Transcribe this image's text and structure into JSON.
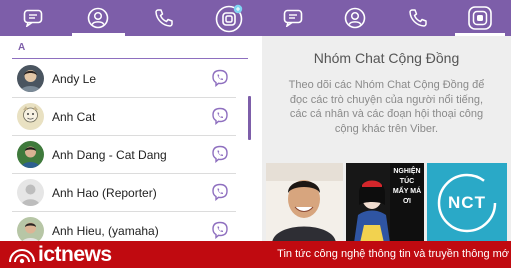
{
  "left_panel": {
    "tabs": [
      {
        "icon": "chat-icon",
        "active": false
      },
      {
        "icon": "contacts-icon",
        "active": true
      },
      {
        "icon": "call-icon",
        "active": false
      },
      {
        "icon": "public-chats-icon",
        "active": false,
        "badge": "new"
      }
    ],
    "section_letter": "A",
    "contacts": [
      {
        "name": "Andy Le"
      },
      {
        "name": "Anh Cat"
      },
      {
        "name": "Anh Dang - Cat Dang"
      },
      {
        "name": "Anh Hao (Reporter)"
      },
      {
        "name": "Anh Hieu, (yamaha)"
      }
    ]
  },
  "right_panel": {
    "tabs": [
      {
        "icon": "chat-icon",
        "active": false
      },
      {
        "icon": "contacts-icon",
        "active": false
      },
      {
        "icon": "call-icon",
        "active": false
      },
      {
        "icon": "public-chats-icon",
        "active": true
      }
    ],
    "title": "Nhóm Chat Cộng Đồng",
    "description": "Theo dõi các Nhóm Chat Cộng Đồng để đọc các trò chuyện của người nổi tiếng, các cá nhân và các đoạn hội thoại công cộng khác trên Viber.",
    "cards": [
      {
        "label": ""
      },
      {
        "label": "NGHIỆN TÚC MẤY MÁ ƠI"
      },
      {
        "label": "NCT"
      }
    ]
  },
  "banner": {
    "brand": "ictnews",
    "tagline": "Tin tức công nghệ thông tin và truyền thông mớ"
  },
  "colors": {
    "accent": "#7d5ea9",
    "banner": "#c00a10"
  }
}
